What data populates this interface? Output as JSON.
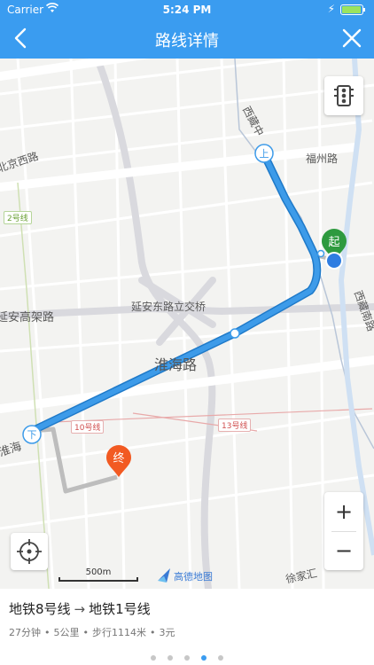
{
  "status_bar": {
    "carrier": "Carrier",
    "time": "5:24 PM"
  },
  "nav": {
    "title": "路线详情",
    "back_icon": "chevron-left-icon",
    "close_icon": "close-icon"
  },
  "map": {
    "labels": {
      "xizang_zhong": "西藏中",
      "fuzhou_road": "福州路",
      "beijing_west": "北京西路",
      "line2": "2号线",
      "yanan_elevated": "延安高架路",
      "yanan_interchange": "延安东路立交桥",
      "huaihai_road": "淮海路",
      "huaihai_short": "淮海",
      "line10": "10号线",
      "line13": "13号线",
      "xizang_south": "西藏南路",
      "xujiahui": "徐家汇"
    },
    "markers": {
      "board": "上",
      "alight": "下",
      "start": "起",
      "end": "终"
    },
    "scale_text": "500m",
    "logo_text": "高德地图",
    "controls": {
      "zoom_in": "+",
      "zoom_out": "−",
      "traffic_icon": "traffic-light-icon",
      "locate_icon": "crosshair-icon"
    },
    "colors": {
      "route": "#3d9be9",
      "walk": "#bdbdbd",
      "start": "#2e9a3f",
      "end": "#f25a22"
    }
  },
  "route": {
    "from_line": "地铁8号线",
    "arrow": "→",
    "to_line": "地铁1号线",
    "duration": "27分钟",
    "distance": "5公里",
    "walking": "步行1114米",
    "price": "3元",
    "separator": "•"
  },
  "pager": {
    "total": 5,
    "active": 3
  }
}
